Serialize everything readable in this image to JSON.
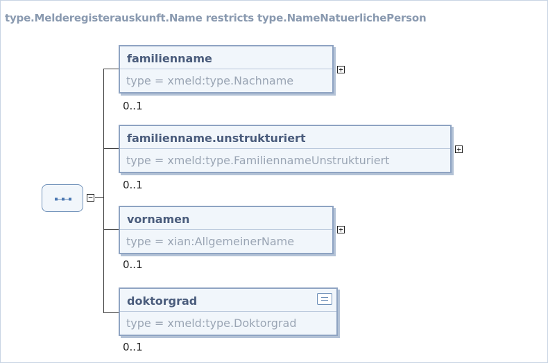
{
  "diagram": {
    "title": "type.Melderegisterauskunft.Name restricts type.NameNatuerlichePerson",
    "elements": [
      {
        "name": "familienname",
        "type": "type = xmeld:type.Nachname",
        "cardinality": "0..1",
        "expander": "+"
      },
      {
        "name": "familienname.unstrukturiert",
        "type": "type = xmeld:type.FamiliennameUnstrukturiert",
        "cardinality": "0..1",
        "expander": "+"
      },
      {
        "name": "vornamen",
        "type": "type = xian:AllgemeinerName",
        "cardinality": "0..1",
        "expander": "+"
      },
      {
        "name": "doktorgrad",
        "type": "type = xmeld:type.Doktorgrad",
        "cardinality": "0..1",
        "icon": "documentation-icon"
      }
    ],
    "sequence": {
      "icon": "sequence-icon",
      "collapse": "−"
    },
    "colors": {
      "border": "#8ea3c2",
      "fill": "#f1f6fb",
      "title": "#8a9ab0",
      "name": "#4a5c7c",
      "type": "#9aa5b4"
    }
  }
}
